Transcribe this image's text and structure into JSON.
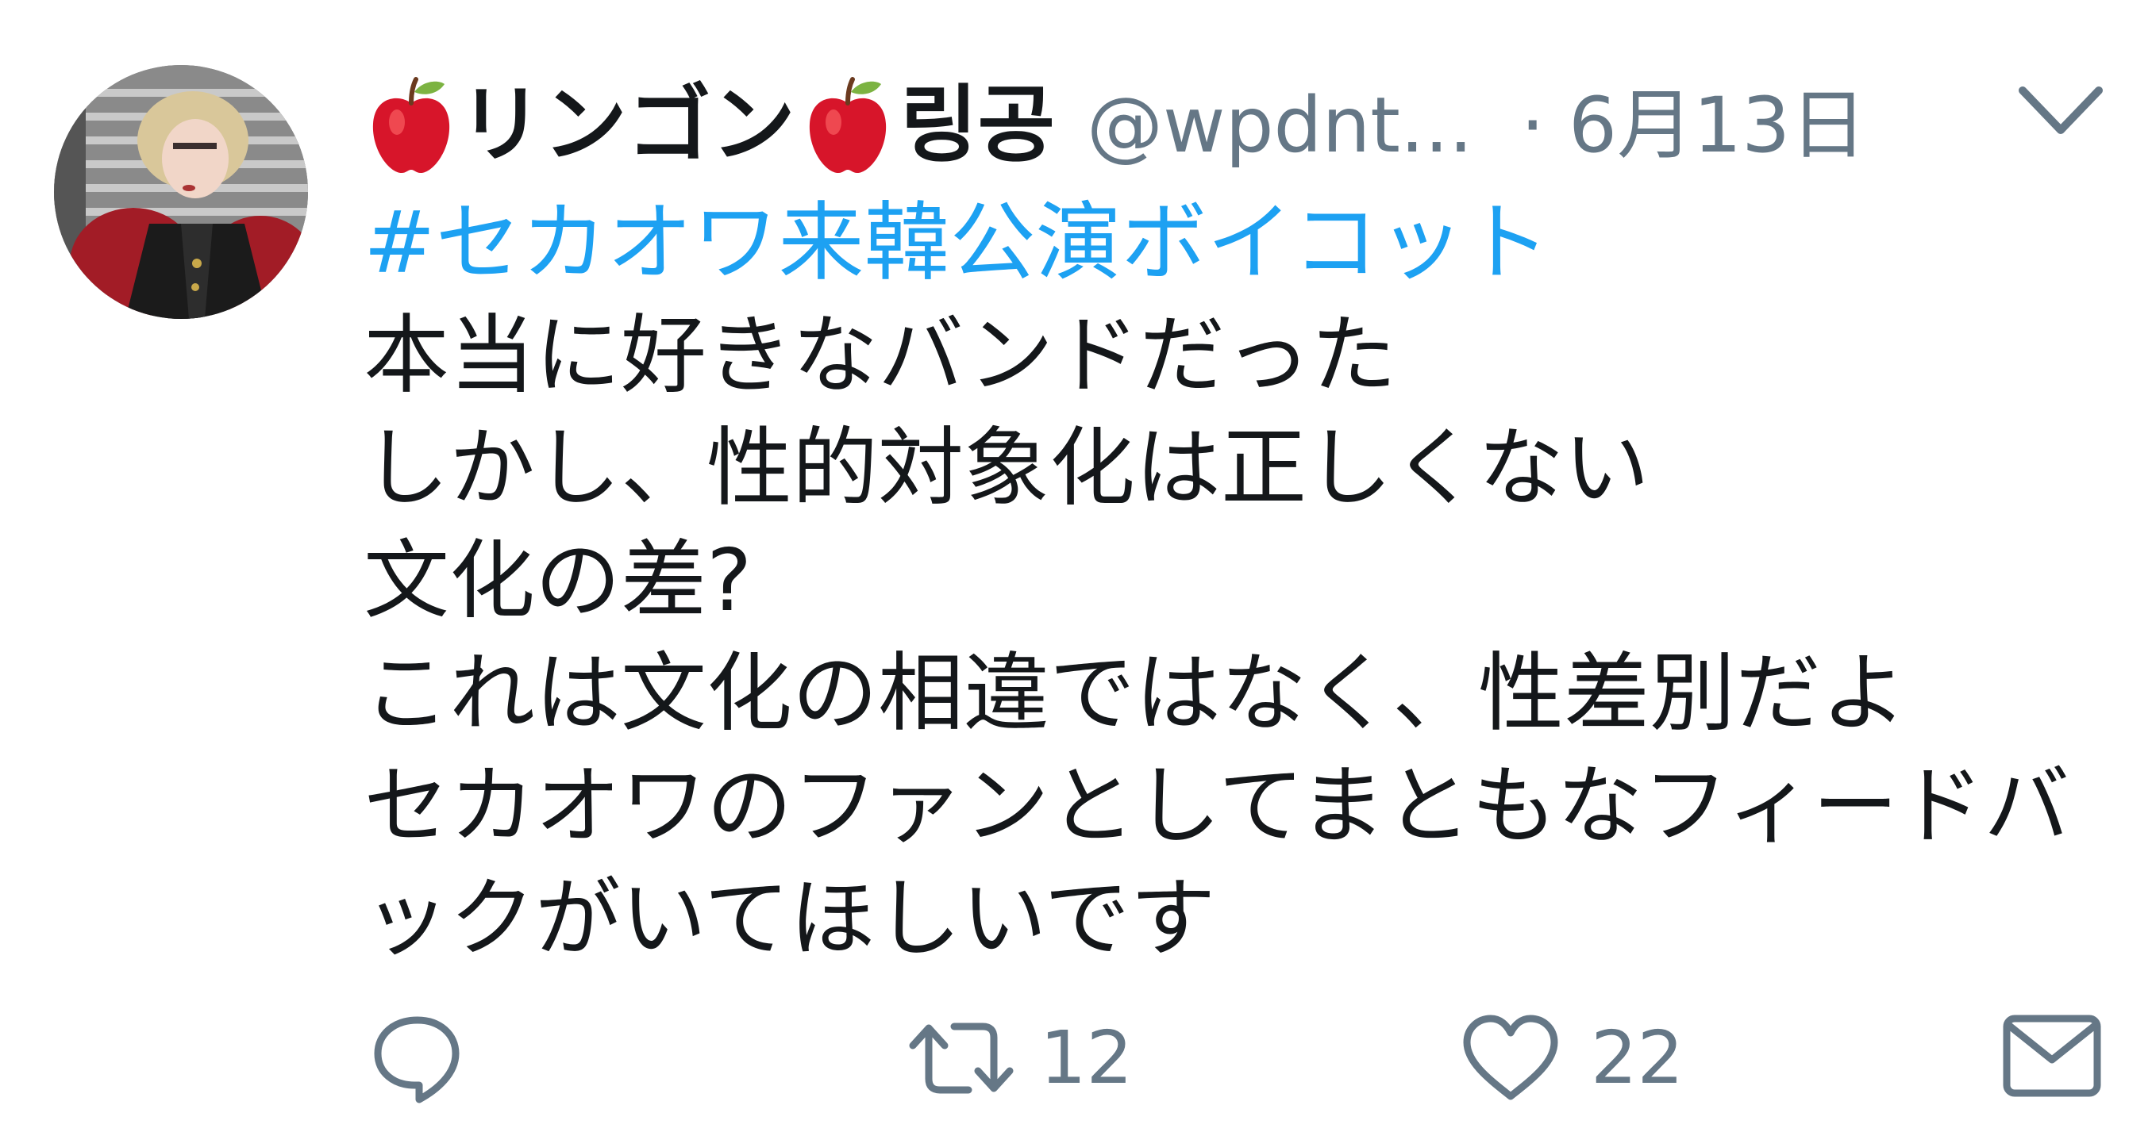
{
  "tweet": {
    "display_name_1": "リンゴン",
    "display_name_2": "링공",
    "name_icon": "red-apple-emoji",
    "handle": "@wpdnt...",
    "separator": "·",
    "date": "6月13日",
    "hashtag": "#セカオワ来韓公演ボイコット",
    "lines": [
      "本当に好きなバンドだった",
      "しかし、性的対象化は正しくない",
      "文化の差?",
      "これは文化の相違ではなく、性差別だよ",
      "セカオワのファンとしてまともなフィードバ",
      "ックがいてほしいです"
    ],
    "actions": {
      "reply_icon": "speech-bubble-icon",
      "retweet_icon": "retweet-arrows-icon",
      "retweet_count": "12",
      "like_icon": "heart-icon",
      "like_count": "22",
      "dm_icon": "envelope-icon"
    }
  },
  "colors": {
    "text": "#14171a",
    "secondary": "#657786",
    "link": "#1da1f2",
    "apple": "#d7152a",
    "apple_leaf": "#7cb342"
  }
}
